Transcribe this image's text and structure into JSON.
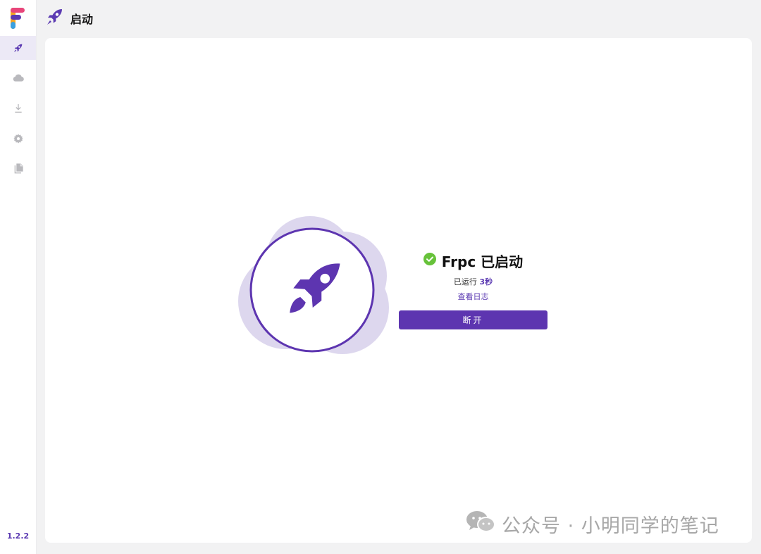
{
  "header": {
    "title": "启动",
    "icon": "rocket-icon"
  },
  "sidebar": {
    "logo": "app-logo",
    "items": [
      {
        "name": "rocket-icon",
        "active": true
      },
      {
        "name": "cloud-icon",
        "active": false
      },
      {
        "name": "download-icon",
        "active": false
      },
      {
        "name": "gear-icon",
        "active": false
      },
      {
        "name": "document-icon",
        "active": false
      }
    ],
    "version": "1.2.2"
  },
  "main": {
    "status_title": "Frpc 已启动",
    "runtime_label": "已运行",
    "runtime_value": "3秒",
    "view_logs": "查看日志",
    "disconnect_label": "断开"
  },
  "watermark": {
    "text": "公众号 · 小明同学的笔记",
    "icon": "wechat-icon"
  },
  "colors": {
    "accent": "#5d35b0",
    "accent_light": "#ddd7ee",
    "success": "#67c23a",
    "sidebar_active_bg": "#ece9f6"
  }
}
